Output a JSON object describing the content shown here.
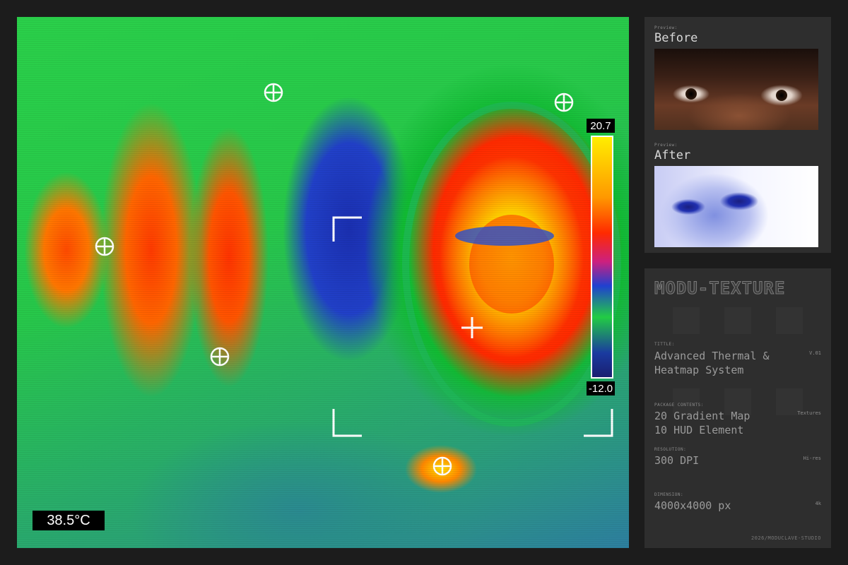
{
  "thermal": {
    "temperature": "38.5°C",
    "scale_max": "20.7",
    "scale_min": "-12.0"
  },
  "preview": {
    "before_small": "Preview:",
    "before_label": "Before",
    "after_small": "Preview:",
    "after_label": "After"
  },
  "info": {
    "logo": "MODU-TEXTURE",
    "title_small": "TITTLE:",
    "title_line1": "Advanced Thermal &",
    "title_line2": "Heatmap System",
    "version": "V.01",
    "package_small": "PACKAGE CONTENTS:",
    "package_line1": "20 Gradient Map",
    "package_line2": "10 HUD Element",
    "package_right": "Textures",
    "resolution_small": "RESOLUTION:",
    "resolution_value": "300 DPI",
    "resolution_right": "Hi-res",
    "dimension_small": "DIMENSION:",
    "dimension_value": "4000x4000 px",
    "dimension_right": "4k",
    "footer": "2026/MODUCLAVE-STUDIO"
  },
  "colors": {
    "background": "#1c1c1c",
    "panel": "#2e2e2e",
    "hot": "#ffff00",
    "warm": "#ff3300",
    "cool": "#22cc44",
    "cold": "#1a2fb0"
  }
}
